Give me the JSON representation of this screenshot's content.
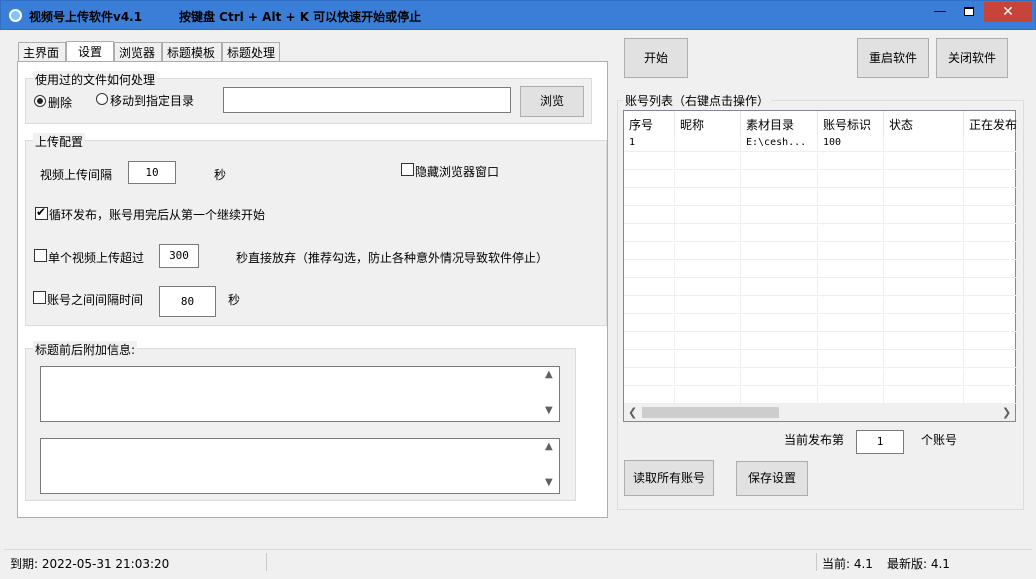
{
  "window": {
    "title": "视频号上传软件v4.1",
    "hint": "按键盘 Ctrl + Alt + K  可以快速开始或停止",
    "min_glyph": "—",
    "close_glyph": "✕"
  },
  "tabs": [
    {
      "label": "主界面"
    },
    {
      "label": "设置"
    },
    {
      "label": "浏览器"
    },
    {
      "label": "标题模板"
    },
    {
      "label": "标题处理"
    }
  ],
  "file_handling": {
    "group_label": "使用过的文件如何处理",
    "delete_label": "删除",
    "move_label": "移动到指定目录",
    "dir_value": "",
    "browse_label": "浏览"
  },
  "upload_config": {
    "group_label": "上传配置",
    "interval_label": "视频上传间隔",
    "interval_value": "10",
    "interval_unit": "秒",
    "hide_browser_label": "隐藏浏览器窗口",
    "loop_label": "循环发布，账号用完后从第一个继续开始",
    "timeout_label": "单个视频上传超过",
    "timeout_value": "300",
    "timeout_suffix": "秒直接放弃（推荐勾选，防止各种意外情况导致软件停止）",
    "account_interval_label": "账号之间间隔时间",
    "account_interval_value": "80",
    "account_interval_unit": "秒"
  },
  "title_extra": {
    "group_label": "标题前后附加信息:",
    "prefix_value": "",
    "suffix_value": ""
  },
  "actions": {
    "start_label": "开始",
    "restart_label": "重启软件",
    "close_label": "关闭软件",
    "read_accounts_label": "读取所有账号",
    "save_settings_label": "保存设置"
  },
  "accounts": {
    "group_label": "账号列表（右键点击操作）",
    "columns": [
      "序号",
      "昵称",
      "素材目录",
      "账号标识",
      "状态",
      "正在发布"
    ],
    "rows": [
      [
        "1",
        "",
        "E:\\cesh...",
        "100",
        "",
        ""
      ]
    ],
    "current_prefix": "当前发布第",
    "current_value": "1",
    "current_suffix": "个账号"
  },
  "status": {
    "expiry": "到期:  2022-05-31 21:03:20",
    "current_version": "当前:  4.1",
    "latest_version": "最新版:  4.1"
  }
}
